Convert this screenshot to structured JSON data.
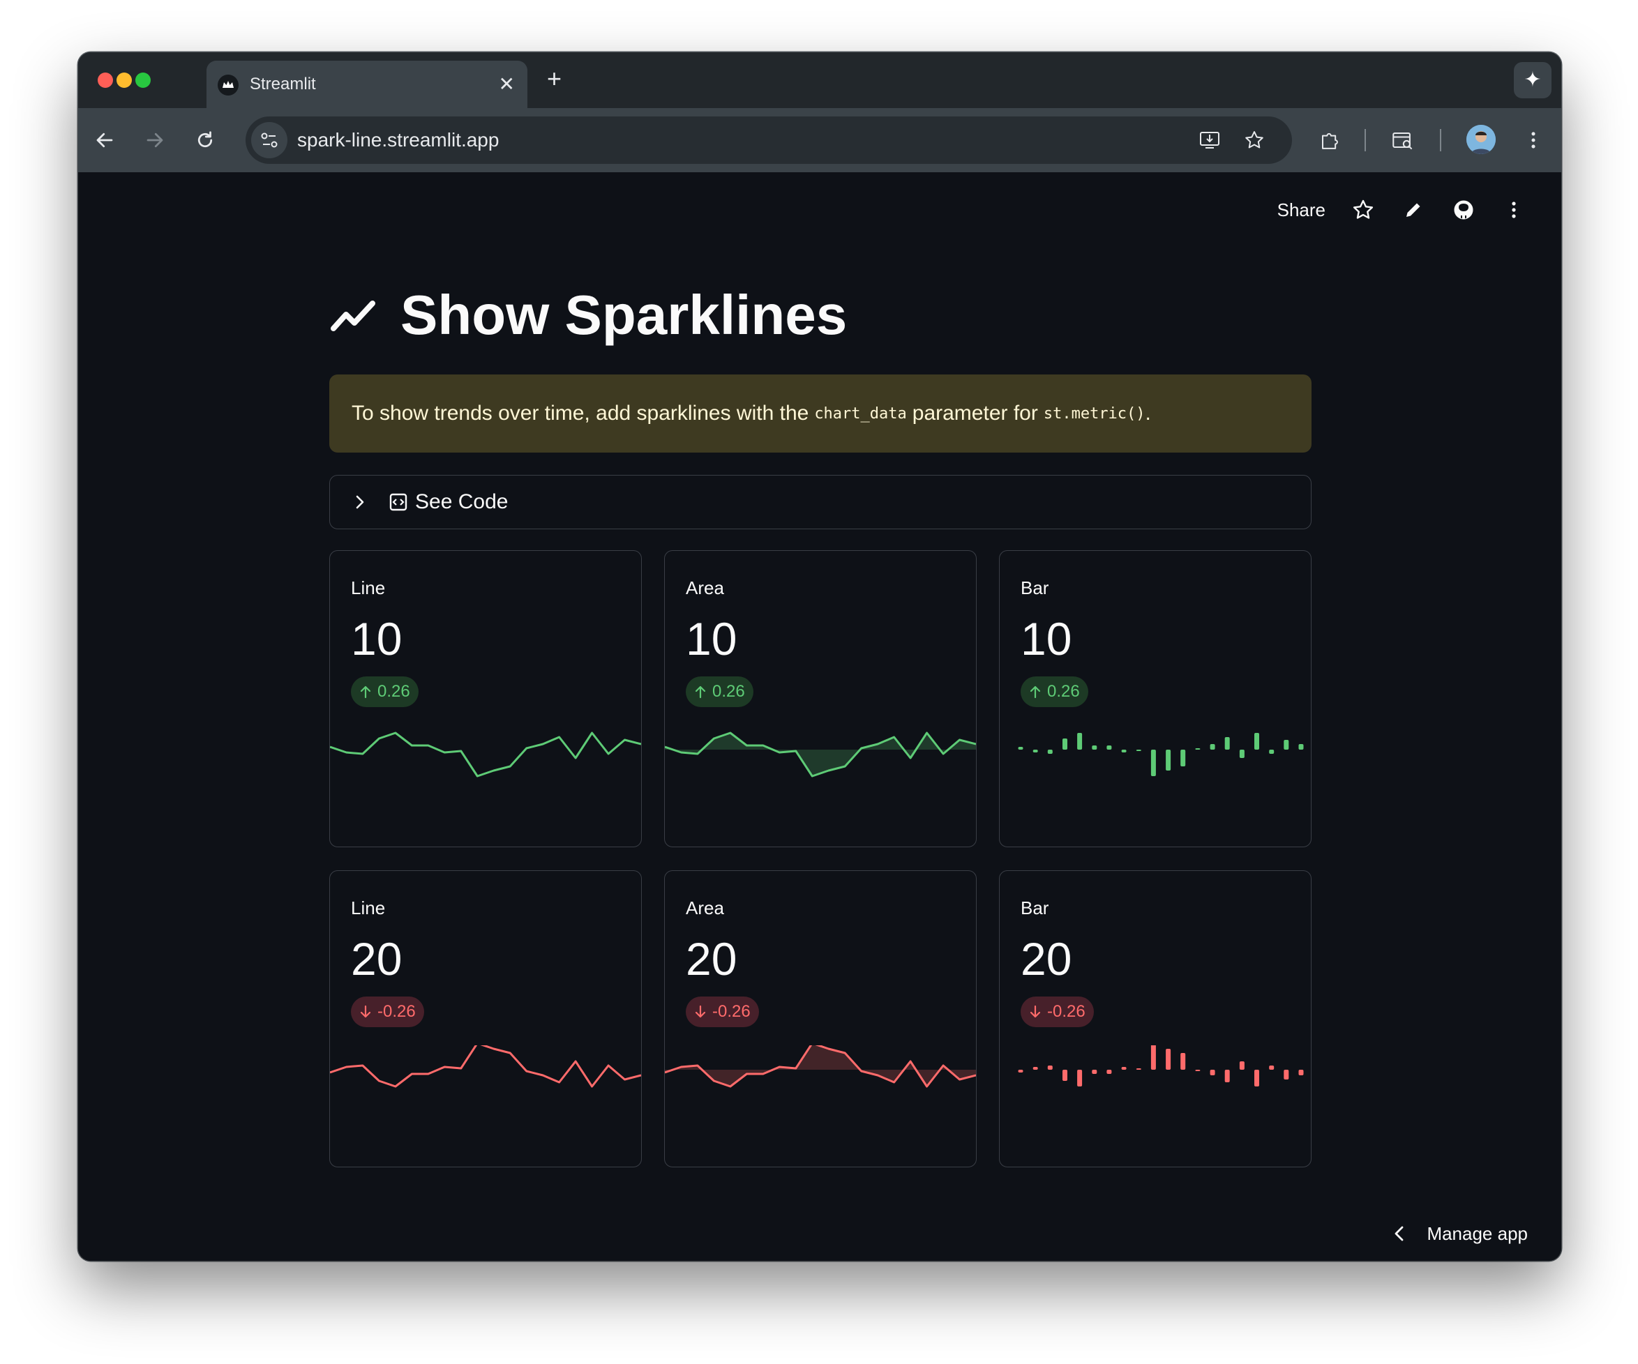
{
  "browser": {
    "tab_title": "Streamlit",
    "new_tab_glyph": "+",
    "close_glyph": "✕",
    "gemini_glyph": "✦",
    "url": "spark-line.streamlit.app",
    "traffic_lights": [
      "#ff5f57",
      "#febc2e",
      "#28c840"
    ]
  },
  "app": {
    "header": {
      "share_label": "Share"
    },
    "title": "Show Sparklines",
    "alert": {
      "text_before": "To show trends over time, add sparklines with the",
      "code_1": "chart_data",
      "text_middle": "parameter for",
      "code_2": "st.metric()",
      "text_after": "."
    },
    "expander_label": "See Code",
    "manage_label": "Manage app",
    "colors": {
      "up": "#5ecb76",
      "down": "#ff6b6b",
      "alert_bg": "#3e3a21",
      "app_bg": "#0e1117"
    },
    "metrics": [
      {
        "label": "Line",
        "value": "10",
        "delta": "0.26",
        "direction": "up",
        "chart": "line"
      },
      {
        "label": "Area",
        "value": "10",
        "delta": "0.26",
        "direction": "up",
        "chart": "area"
      },
      {
        "label": "Bar",
        "value": "10",
        "delta": "0.26",
        "direction": "up",
        "chart": "bar"
      },
      {
        "label": "Line",
        "value": "20",
        "delta": "-0.26",
        "direction": "down",
        "chart": "line"
      },
      {
        "label": "Area",
        "value": "20",
        "delta": "-0.26",
        "direction": "down",
        "chart": "area"
      },
      {
        "label": "Bar",
        "value": "20",
        "delta": "-0.26",
        "direction": "down",
        "chart": "bar"
      }
    ],
    "sparkline_up": [
      0.1,
      -0.1,
      -0.15,
      0.4,
      0.6,
      0.15,
      0.15,
      -0.1,
      -0.05,
      -0.95,
      -0.75,
      -0.6,
      0.05,
      0.2,
      0.45,
      -0.3,
      0.6,
      -0.15,
      0.35,
      0.2
    ],
    "sparkline_down": [
      -0.1,
      0.1,
      0.15,
      -0.4,
      -0.6,
      -0.15,
      -0.15,
      0.1,
      0.05,
      0.95,
      0.75,
      0.6,
      -0.05,
      -0.2,
      -0.45,
      0.3,
      -0.6,
      0.15,
      -0.35,
      -0.2
    ]
  }
}
